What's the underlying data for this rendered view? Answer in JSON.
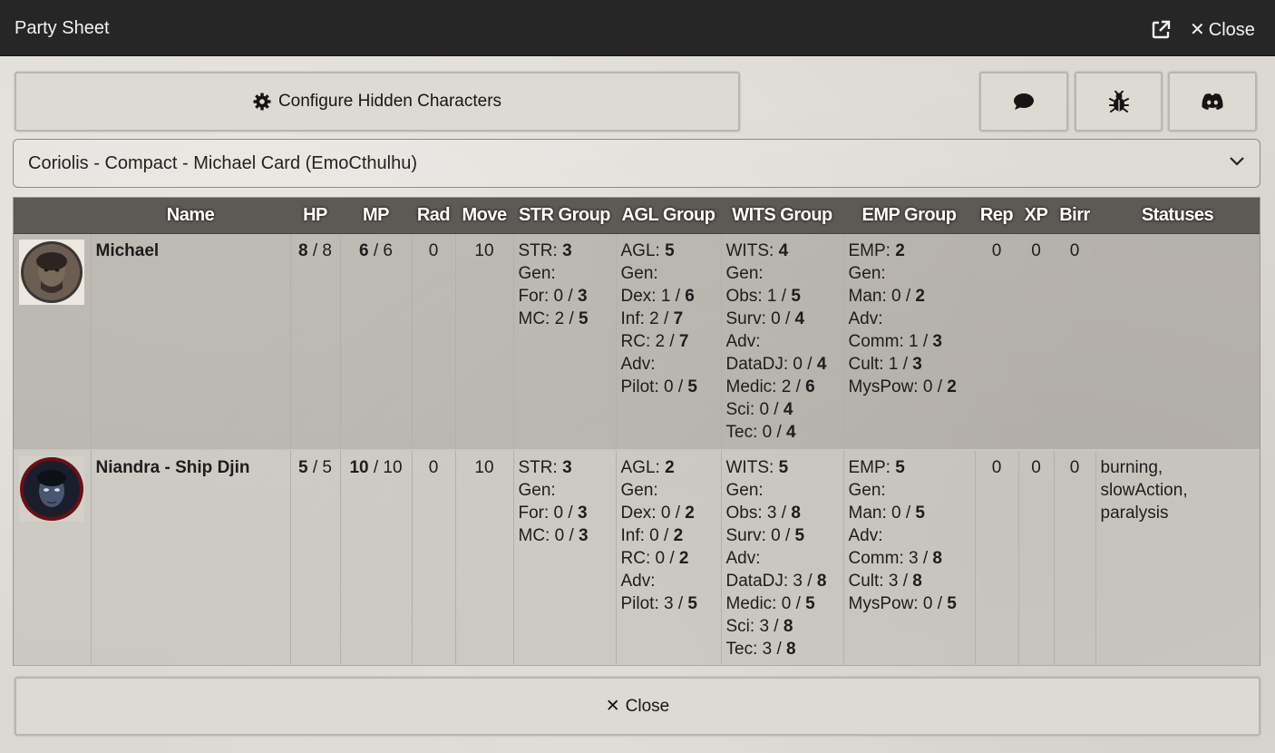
{
  "window": {
    "title": "Party Sheet",
    "close_label": "Close"
  },
  "toolbar": {
    "configure_label": "Configure Hidden Characters"
  },
  "select": {
    "value": "Coriolis - Compact - Michael Card (EmoCthulhu)"
  },
  "table": {
    "headers": [
      "Name",
      "HP",
      "MP",
      "Rad",
      "Move",
      "STR Group",
      "AGL Group",
      "WITS Group",
      "EMP Group",
      "Rep",
      "XP",
      "Birr",
      "Statuses"
    ],
    "rows": [
      {
        "name": "Michael",
        "hp": {
          "cur": "8",
          "max": "8"
        },
        "mp": {
          "cur": "6",
          "max": "6"
        },
        "rad": "0",
        "move": "10",
        "str": [
          {
            "label": "STR: ",
            "val": "3"
          },
          {
            "label": "Gen:",
            "val": ""
          },
          {
            "label": "For: 0 / ",
            "val": "3"
          },
          {
            "label": "MC: 2 / ",
            "val": "5"
          }
        ],
        "agl": [
          {
            "label": "AGL: ",
            "val": "5"
          },
          {
            "label": "Gen:",
            "val": ""
          },
          {
            "label": "Dex: 1 / ",
            "val": "6"
          },
          {
            "label": "Inf: 2 / ",
            "val": "7"
          },
          {
            "label": "RC: 2 / ",
            "val": "7"
          },
          {
            "label": "Adv:",
            "val": ""
          },
          {
            "label": "Pilot: 0 / ",
            "val": "5"
          }
        ],
        "wits": [
          {
            "label": "WITS: ",
            "val": "4"
          },
          {
            "label": "Gen:",
            "val": ""
          },
          {
            "label": "Obs: 1 / ",
            "val": "5"
          },
          {
            "label": "Surv: 0 / ",
            "val": "4"
          },
          {
            "label": "Adv:",
            "val": ""
          },
          {
            "label": "DataDJ: 0 / ",
            "val": "4"
          },
          {
            "label": "Medic: 2 / ",
            "val": "6"
          },
          {
            "label": "Sci: 0 / ",
            "val": "4"
          },
          {
            "label": "Tec: 0 / ",
            "val": "4"
          }
        ],
        "emp": [
          {
            "label": "EMP: ",
            "val": "2"
          },
          {
            "label": "Gen:",
            "val": ""
          },
          {
            "label": "Man: 0 / ",
            "val": "2"
          },
          {
            "label": "Adv:",
            "val": ""
          },
          {
            "label": "Comm: 1 / ",
            "val": "3"
          },
          {
            "label": "Cult: 1 / ",
            "val": "3"
          },
          {
            "label": "MysPow: 0 / ",
            "val": "2"
          }
        ],
        "rep": "0",
        "xp": "0",
        "birr": "0",
        "statuses": ""
      },
      {
        "name": "Niandra - Ship Djin",
        "hp": {
          "cur": "5",
          "max": "5"
        },
        "mp": {
          "cur": "10",
          "max": "10"
        },
        "rad": "0",
        "move": "10",
        "str": [
          {
            "label": "STR: ",
            "val": "3"
          },
          {
            "label": "Gen:",
            "val": ""
          },
          {
            "label": "For: 0 / ",
            "val": "3"
          },
          {
            "label": "MC: 0 / ",
            "val": "3"
          }
        ],
        "agl": [
          {
            "label": "AGL: ",
            "val": "2"
          },
          {
            "label": "Gen:",
            "val": ""
          },
          {
            "label": "Dex: 0 / ",
            "val": "2"
          },
          {
            "label": "Inf: 0 / ",
            "val": "2"
          },
          {
            "label": "RC: 0 / ",
            "val": "2"
          },
          {
            "label": "Adv:",
            "val": ""
          },
          {
            "label": "Pilot: 3 / ",
            "val": "5"
          }
        ],
        "wits": [
          {
            "label": "WITS: ",
            "val": "5"
          },
          {
            "label": "Gen:",
            "val": ""
          },
          {
            "label": "Obs: 3 / ",
            "val": "8"
          },
          {
            "label": "Surv: 0 / ",
            "val": "5"
          },
          {
            "label": "Adv:",
            "val": ""
          },
          {
            "label": "DataDJ: 3 / ",
            "val": "8"
          },
          {
            "label": "Medic: 0 / ",
            "val": "5"
          },
          {
            "label": "Sci: 3 / ",
            "val": "8"
          },
          {
            "label": "Tec: 3 / ",
            "val": "8"
          }
        ],
        "emp": [
          {
            "label": "EMP: ",
            "val": "5"
          },
          {
            "label": "Gen:",
            "val": ""
          },
          {
            "label": "Man: 0 / ",
            "val": "5"
          },
          {
            "label": "Adv:",
            "val": ""
          },
          {
            "label": "Comm: 3 / ",
            "val": "8"
          },
          {
            "label": "Cult: 3 / ",
            "val": "8"
          },
          {
            "label": "MysPow: 0 / ",
            "val": "5"
          }
        ],
        "rep": "0",
        "xp": "0",
        "birr": "0",
        "statuses": [
          "burning,",
          "slowAction,",
          "paralysis"
        ]
      }
    ]
  },
  "footer": {
    "close_label": "Close"
  },
  "icons": {
    "popout": "external-link-icon",
    "close": "close-icon",
    "config": "gear-icon",
    "chat": "chat-bubble-icon",
    "bug": "bug-icon",
    "discord": "discord-icon",
    "dropdown": "chevron-down-icon"
  }
}
